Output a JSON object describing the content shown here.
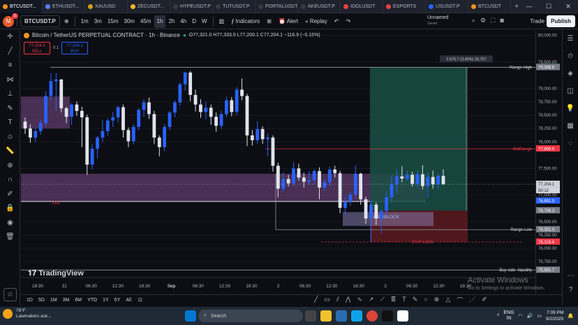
{
  "tabs": [
    {
      "label": "BTCUSDT...",
      "color": "#f7931a"
    },
    {
      "label": "ETHUSDT...",
      "color": "#627eea"
    },
    {
      "label": "XAUUSD",
      "color": "#d4a017"
    },
    {
      "label": "ZECUSDT...",
      "color": "#f4b728"
    },
    {
      "label": "HYPEUSDT.P",
      "color": "#3a3a3a"
    },
    {
      "label": "TUTUSDT.P",
      "color": "#3a3a3a"
    },
    {
      "label": "PORTALUSDT",
      "color": "#3a3a3a"
    },
    {
      "label": "AKEUSDT.P",
      "color": "#3a3a3a"
    },
    {
      "label": "IDOLUSDT",
      "color": "#e84142"
    },
    {
      "label": "ESPORTS",
      "color": "#e84142"
    },
    {
      "label": "USUSDT.P",
      "color": "#2962ff"
    },
    {
      "label": "BTCUSDT",
      "color": "#f7931a"
    }
  ],
  "toolbar": {
    "avatar": "M",
    "avatar_badge": "11",
    "symbol": "BTCUSDT.P",
    "intervals": [
      "1m",
      "3m",
      "15m",
      "30m",
      "45m",
      "1h",
      "2h",
      "4h",
      "D",
      "W"
    ],
    "selected_interval": "1h",
    "indicators": "Indicators",
    "alert": "Alert",
    "replay": "Replay",
    "layout_name": "Unnamed",
    "layout_status": "Saved",
    "trade": "Trade",
    "publish": "Publish"
  },
  "header": {
    "title": "Bitcoin / TetherUS PERPETUAL CONTRACT · 1h · Binance",
    "ohlc": "O77,321.0 H77,333.5 L77,200.1 C77,204.1 −116.9 (−0.15%)",
    "sell_price": "77,204.0",
    "sell_label": "SELL",
    "spread": "0.1",
    "buy_price": "77,204.1",
    "buy_label": "BUY"
  },
  "chart_data": {
    "type": "candlestick",
    "symbol": "BTCUSDT.P",
    "interval": "1h",
    "exchange": "Binance",
    "ylim": [
      75450,
      80100
    ],
    "price_ticks": [
      80000,
      79500,
      79000,
      78750,
      78500,
      78250,
      78000,
      77500,
      77000,
      76500,
      76250,
      76000,
      75750
    ],
    "time_ticks": [
      "18:30",
      "31",
      "06:30",
      "12:30",
      "18:30",
      "Sep",
      "06:30",
      "12:30",
      "18:30",
      "2",
      "06:30",
      "12:30",
      "18:30",
      "3",
      "06:30",
      "12:30",
      "18:30"
    ],
    "candles": [
      [
        78380,
        78250,
        78460,
        78150
      ],
      [
        78250,
        78080,
        78330,
        77980
      ],
      [
        78080,
        78200,
        78260,
        78000
      ],
      [
        78200,
        78350,
        78420,
        78130
      ],
      [
        78350,
        78860,
        78950,
        78300
      ],
      [
        78860,
        79140,
        79290,
        78780
      ],
      [
        79140,
        79170,
        79290,
        78580
      ],
      [
        79170,
        78630,
        79180,
        78550
      ],
      [
        78630,
        78470,
        78660,
        78350
      ],
      [
        78470,
        78700,
        78730,
        78320
      ],
      [
        78700,
        78580,
        78760,
        78490
      ],
      [
        78580,
        78460,
        78660,
        77900
      ],
      [
        78460,
        77570,
        78510,
        77380
      ],
      [
        77570,
        77870,
        77960,
        77480
      ],
      [
        77870,
        78080,
        78110,
        77690
      ],
      [
        78080,
        78200,
        78410,
        77990
      ],
      [
        78200,
        78400,
        78440,
        78110
      ],
      [
        78400,
        78460,
        78560,
        78280
      ],
      [
        78460,
        78650,
        78680,
        78360
      ],
      [
        78650,
        78220,
        78700,
        78080
      ],
      [
        78220,
        78010,
        78270,
        77900
      ],
      [
        78010,
        78280,
        78330,
        77950
      ],
      [
        78280,
        78600,
        78630,
        78210
      ],
      [
        78600,
        78740,
        78800,
        78470
      ],
      [
        78740,
        78520,
        78830,
        78430
      ],
      [
        78520,
        78080,
        78580,
        77960
      ],
      [
        78080,
        77900,
        78120,
        77730
      ],
      [
        77900,
        78280,
        78330,
        77820
      ],
      [
        78280,
        78550,
        78580,
        78220
      ],
      [
        78550,
        78740,
        78780,
        78460
      ],
      [
        78740,
        79080,
        79120,
        78680
      ],
      [
        79080,
        79300,
        79320,
        78960
      ],
      [
        79300,
        78880,
        79330,
        78760
      ],
      [
        78880,
        78700,
        78980,
        78570
      ],
      [
        78700,
        78560,
        78800,
        78450
      ],
      [
        78560,
        78640,
        78750,
        78420
      ],
      [
        78640,
        78470,
        78700,
        78320
      ],
      [
        78470,
        78300,
        78550,
        78190
      ],
      [
        78300,
        78520,
        78580,
        78240
      ],
      [
        78520,
        78780,
        78850,
        78460
      ],
      [
        78780,
        78560,
        78840,
        78480
      ],
      [
        78560,
        78980,
        79030,
        78500
      ],
      [
        78980,
        78860,
        79190,
        78780
      ],
      [
        78860,
        78120,
        78900,
        77920
      ],
      [
        78120,
        78030,
        78220,
        77930
      ],
      [
        78030,
        78240,
        78380,
        77960
      ],
      [
        78240,
        78050,
        78290,
        77960
      ],
      [
        78050,
        78080,
        78160,
        77730
      ],
      [
        78080,
        77550,
        78120,
        77440
      ],
      [
        77550,
        77120,
        77610,
        76960
      ],
      [
        77120,
        77300,
        77420,
        77060
      ],
      [
        77300,
        77220,
        77380,
        77160
      ],
      [
        77220,
        77500,
        77620,
        77160
      ],
      [
        77500,
        77330,
        77590,
        77270
      ],
      [
        77330,
        77250,
        77420,
        77140
      ],
      [
        77250,
        77280,
        77450,
        77190
      ],
      [
        77280,
        77450,
        77490,
        77200
      ],
      [
        77450,
        77140,
        77520,
        76920
      ],
      [
        77140,
        77240,
        77300,
        77080
      ],
      [
        77240,
        77480,
        77530,
        77160
      ],
      [
        77480,
        77410,
        77550,
        77330
      ],
      [
        77410,
        76760,
        77460,
        76660
      ],
      [
        76760,
        76880,
        76960,
        76640
      ],
      [
        76880,
        77010,
        77060,
        76800
      ],
      [
        77010,
        77400,
        77560,
        76930
      ],
      [
        77400,
        76920,
        77420,
        76820
      ],
      [
        76920,
        76560,
        76970,
        76460
      ],
      [
        76560,
        76820,
        76900,
        76120
      ],
      [
        76820,
        76560,
        76860,
        76440
      ],
      [
        76560,
        76700,
        76730,
        76280
      ],
      [
        76700,
        76960,
        77070,
        76630
      ],
      [
        76960,
        77200,
        77360,
        76890
      ],
      [
        77200,
        77350,
        77480,
        77030
      ],
      [
        77350,
        77310,
        77540,
        77240
      ],
      [
        77310,
        77380,
        77460,
        77270
      ],
      [
        77380,
        77210,
        77440,
        77160
      ],
      [
        77210,
        77390,
        77460,
        77150
      ],
      [
        77390,
        77170,
        77560,
        77110
      ],
      [
        77170,
        77340,
        77420,
        76950
      ],
      [
        77340,
        77200,
        77460,
        77120
      ],
      [
        77200,
        77360,
        77400,
        77100
      ],
      [
        77360,
        77204,
        77480,
        77190
      ]
    ],
    "levels": [
      {
        "label": "Range-High",
        "price": 79398.6
      },
      {
        "label": "MidRange",
        "price": 77869.5
      },
      {
        "label": "Range-Low",
        "price": 76351.0
      },
      {
        "label": "STOP LOSS",
        "price": 76119.4
      },
      {
        "label": "Buy side- liquidity",
        "price": 75591.7
      }
    ],
    "zones": [
      {
        "label": "orderBLOCK",
        "top": 76680,
        "bottom": 76420
      },
      {
        "label": "XXX",
        "top": 77400,
        "bottom": 76880
      }
    ],
    "position_tool": {
      "profit_label": "2,675.7 (3.49%) 26,757",
      "target": 79400.9,
      "entry": 76708.3,
      "stop": 76119.4
    },
    "axis_labels": [
      {
        "price": 79400.9,
        "text": "79,400.9",
        "color": "#26a69a"
      },
      {
        "price": 79398.6,
        "text": "79,398.6",
        "color": "#787b86"
      },
      {
        "price": 77869.5,
        "text": "77,869.5",
        "color": "#f23645"
      },
      {
        "price": 77204.1,
        "text": "77,204.1",
        "color": "#d1d4dc",
        "sub": "50:12"
      },
      {
        "price": 76891.5,
        "text": "76,891.5",
        "color": "#2962ff"
      },
      {
        "price": 76708.3,
        "text": "76,708.3",
        "color": "#787b86"
      },
      {
        "price": 76351.0,
        "text": "76,351.0",
        "color": "#787b86"
      },
      {
        "price": 76119.4,
        "text": "76,119.4",
        "color": "#f23645"
      },
      {
        "price": 75591.7,
        "text": "75,591.7",
        "color": "#787b86"
      }
    ],
    "colors": {
      "up": "#2962ff",
      "down": "#e0e3eb",
      "zone": "#7b4a8a",
      "target": "#1a4f45",
      "stop": "#5c1a20"
    }
  },
  "bottom": {
    "ranges": [
      "1D",
      "5D",
      "1M",
      "3M",
      "6M",
      "YTD",
      "1Y",
      "5Y",
      "All"
    ]
  },
  "watermark": {
    "title": "Activate Windows",
    "subtitle": "Go to Settings to activate Windows."
  },
  "tv_logo": "TradingView",
  "taskbar": {
    "weather_temp": "76°F",
    "weather_text": "Lawmakers ask...",
    "search": "Search",
    "lang": "ENG",
    "region": "IN",
    "time": "7:09 PM",
    "date": "9/2/2025"
  }
}
